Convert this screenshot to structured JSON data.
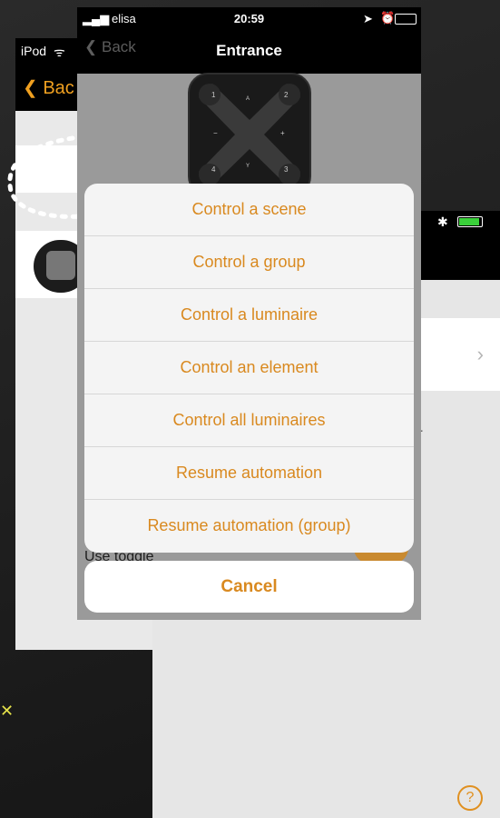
{
  "left_phone": {
    "status": "iPod",
    "back_label": "Bac"
  },
  "front_phone": {
    "status_left": "elisa",
    "time": "20:59",
    "back_label": "Back",
    "title": "Entrance",
    "keypad_labels": [
      "1",
      "2",
      "3",
      "4",
      "A",
      "Y",
      "+",
      "−"
    ]
  },
  "action_sheet": {
    "items": [
      "Control a scene",
      "Control a group",
      "Control a luminaire",
      "Control an element",
      "Control all luminaires",
      "Resume automation",
      "Resume automation (group)"
    ],
    "cancel_label": "Cancel"
  },
  "behind_sheet": {
    "partial_text": "Use toggle"
  },
  "right_phone": {
    "partial_letter": "r",
    "help_icon": "?"
  },
  "colors": {
    "accent": "#d9891f",
    "battery": "#3ad13a"
  }
}
